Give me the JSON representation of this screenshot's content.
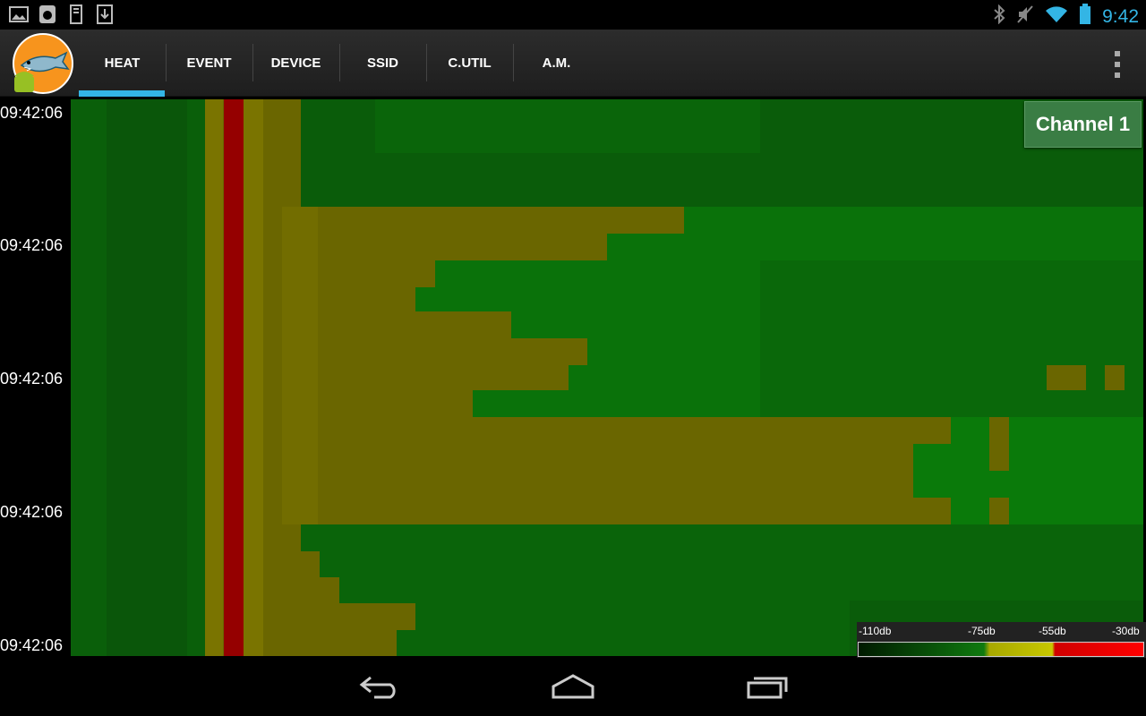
{
  "status_bar": {
    "time": "9:42",
    "left_icons": [
      "gallery-icon",
      "sync-icon",
      "sd-card-icon",
      "download-icon"
    ],
    "right_icons": [
      "bluetooth-icon",
      "mute-icon",
      "wifi-icon",
      "battery-icon"
    ]
  },
  "action_bar": {
    "tabs": [
      {
        "label": "HEAT",
        "active": true
      },
      {
        "label": "EVENT",
        "active": false
      },
      {
        "label": "DEVICE",
        "active": false
      },
      {
        "label": "SSID",
        "active": false
      },
      {
        "label": "C.UTIL",
        "active": false
      },
      {
        "label": "A.M.",
        "active": false
      }
    ]
  },
  "heatmap": {
    "channel_label": "Channel 1",
    "time_labels": [
      "09:42:06",
      "09:42:06",
      "09:42:06",
      "09:42:06",
      "09:42:06"
    ],
    "legend": {
      "labels": [
        "-110db",
        "-75db",
        "-55db",
        "-30db"
      ],
      "colors": {
        "low": "#0a5a0a",
        "mid": "#6a6600",
        "high": "#900000"
      }
    }
  },
  "nav_bar": {
    "buttons": [
      "back-icon",
      "home-icon",
      "recent-apps-icon"
    ]
  }
}
